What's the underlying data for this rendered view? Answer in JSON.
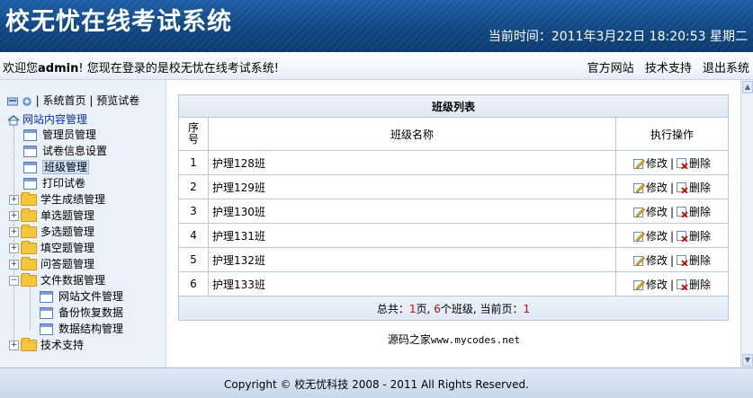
{
  "header": {
    "title": "校无忧在线考试系统",
    "clock_label": "当前时间：",
    "clock_value": "2011年3月22日  18:20:53 星期二"
  },
  "welcome_bar": {
    "prefix": "欢迎您",
    "user": "admin",
    "suffix": "! 您现在登录的是校无忧在线考试系统!",
    "links": [
      "官方网站",
      "技术支持",
      "退出系统"
    ]
  },
  "sidebar": {
    "quick": [
      "| 系统首页",
      "| 预览试卷"
    ],
    "root": "网站内容管理",
    "items": [
      {
        "label": "管理员管理"
      },
      {
        "label": "试卷信息设置"
      },
      {
        "label": "班级管理",
        "selected": true
      },
      {
        "label": "打印试卷"
      }
    ],
    "groups": [
      {
        "label": "学生成绩管理"
      },
      {
        "label": "单选题管理"
      },
      {
        "label": "多选题管理"
      },
      {
        "label": "填空题管理"
      },
      {
        "label": "问答题管理"
      },
      {
        "label": "文件数据管理"
      }
    ],
    "file_children": [
      "网站文件管理",
      "备份恢复数据",
      "数据结构管理"
    ],
    "last_group": "技术支持"
  },
  "table": {
    "caption": "班级列表",
    "headers": {
      "index": "序号",
      "name": "班级名称",
      "ops": "执行操作"
    },
    "rows": [
      {
        "index": "1",
        "name": "护理128班"
      },
      {
        "index": "2",
        "name": "护理129班"
      },
      {
        "index": "3",
        "name": "护理130班"
      },
      {
        "index": "4",
        "name": "护理131班"
      },
      {
        "index": "5",
        "name": "护理132班"
      },
      {
        "index": "6",
        "name": "护理133班"
      }
    ],
    "edit_label": "修改",
    "delete_label": "删除",
    "summary": {
      "p1": "总共：",
      "pages": "1",
      "p2": "页, ",
      "classes": "6",
      "p3": "个班级, 当前页：",
      "current": "1"
    }
  },
  "watermark": {
    "cn": "源码之家",
    "url": "www.mycodes.net"
  },
  "footer": {
    "copyright": "Copyright © 校无忧科技  2008 - 2011 All Rights Reserved."
  },
  "colors": {
    "header_blue": "#124a87",
    "accent_red": "#d10000",
    "border": "#b7c9dd"
  }
}
